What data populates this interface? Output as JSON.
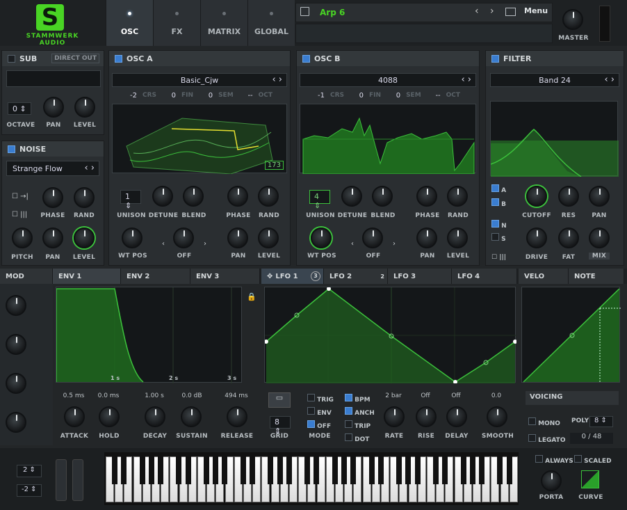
{
  "brand": {
    "name": "STAMMWERK AUDIO",
    "logo_letter": "S"
  },
  "tabs": [
    {
      "label": "OSC"
    },
    {
      "label": "FX"
    },
    {
      "label": "MATRIX"
    },
    {
      "label": "GLOBAL"
    }
  ],
  "preset": {
    "name": "Arp 6",
    "menu_label": "Menu"
  },
  "master_label": "MASTER",
  "sub": {
    "title": "SUB",
    "direct_out": "DIRECT OUT",
    "octave_value": "0",
    "octave_label": "OCTAVE",
    "pan_label": "PAN",
    "level_label": "LEVEL"
  },
  "noise": {
    "title": "NOISE",
    "type": "Strange Flow",
    "phase": "PHASE",
    "rand": "RAND",
    "pitch": "PITCH",
    "pan": "PAN",
    "level": "LEVEL"
  },
  "osc_a": {
    "title": "OSC A",
    "wavetable": "Basic_Cjw",
    "oct": "-2",
    "crs_label": "CRS",
    "fin": "0",
    "fin_label": "FIN",
    "sem": "0",
    "sem_label": "SEM",
    "oct_tail": "--",
    "oct_label": "OCT",
    "frame": "173",
    "unison": "1",
    "unison_label": "UNISON",
    "detune_label": "DETUNE",
    "blend_label": "BLEND",
    "phase_label": "PHASE",
    "rand_label": "RAND",
    "wtpos_label": "WT POS",
    "off_label": "OFF",
    "pan_label": "PAN",
    "level_label": "LEVEL"
  },
  "osc_b": {
    "title": "OSC B",
    "wavetable": "4088",
    "oct": "-1",
    "crs_label": "CRS",
    "fin": "0",
    "fin_label": "FIN",
    "sem": "0",
    "sem_label": "SEM",
    "oct_tail": "--",
    "oct_label": "OCT",
    "unison": "4",
    "unison_label": "UNISON",
    "detune_label": "DETUNE",
    "blend_label": "BLEND",
    "phase_label": "PHASE",
    "rand_label": "RAND",
    "wtpos_label": "WT POS",
    "off_label": "OFF",
    "pan_label": "PAN",
    "level_label": "LEVEL"
  },
  "filter": {
    "title": "FILTER",
    "type": "Band 24",
    "a": "A",
    "b": "B",
    "n": "N",
    "s": "S",
    "cutoff": "CUTOFF",
    "res": "RES",
    "pan": "PAN",
    "drive": "DRIVE",
    "fat": "FAT",
    "mix": "MIX"
  },
  "mod_tabs": [
    {
      "label": "MOD"
    },
    {
      "label": "ENV 1"
    },
    {
      "label": "ENV 2"
    },
    {
      "label": "ENV 3"
    },
    {
      "label": "LFO 1",
      "badge": "3"
    },
    {
      "label": "LFO 2",
      "badge": "2"
    },
    {
      "label": "LFO 3"
    },
    {
      "label": "LFO 4"
    },
    {
      "label": "VELO"
    },
    {
      "label": "NOTE"
    }
  ],
  "env": {
    "ticks": [
      "1 s",
      "2 s",
      "3 s"
    ],
    "values": [
      "0.5 ms",
      "0.0 ms",
      "1.00 s",
      "0.0 dB",
      "494 ms"
    ],
    "labels": [
      "ATTACK",
      "HOLD",
      "DECAY",
      "SUSTAIN",
      "RELEASE"
    ]
  },
  "lfo": {
    "grid_value": "8",
    "grid_label": "GRID",
    "mode_label": "MODE",
    "trig": "TRIG",
    "env": "ENV",
    "off": "OFF",
    "bpm": "BPM",
    "anch": "ANCH",
    "trip": "TRIP",
    "dot": "DOT",
    "rate_value": "2 bar",
    "rise_value": "Off",
    "delay_value": "Off",
    "smooth_value": "0.0",
    "rate": "RATE",
    "rise": "RISE",
    "delay": "DELAY",
    "smooth": "SMOOTH"
  },
  "voicing": {
    "title": "VOICING",
    "mono": "MONO",
    "poly": "POLY",
    "poly_value": "8",
    "legato": "LEGATO",
    "count": "0",
    "total": "/ 48"
  },
  "bottom": {
    "pitch_up": "2",
    "pitch_down": "-2",
    "always": "ALWAYS",
    "scaled": "SCALED",
    "porta": "PORTA",
    "curve": "CURVE"
  },
  "colors": {
    "accent": "#3cc23c",
    "blue": "#3a7dd0",
    "bg": "#232628"
  }
}
